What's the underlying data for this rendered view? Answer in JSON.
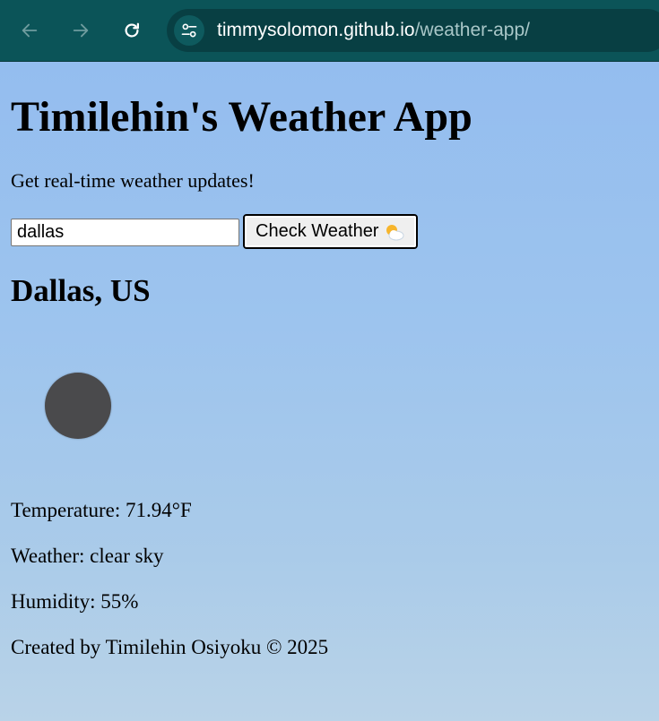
{
  "browser": {
    "url_host": "timmysolomon.github.io",
    "url_path": "/weather-app/",
    "icons": {
      "back": "arrow-left-icon",
      "forward": "arrow-right-icon",
      "reload": "reload-icon",
      "site_info": "tune-icon"
    }
  },
  "page": {
    "title": "Timilehin's Weather App",
    "subtitle": "Get real-time weather updates!",
    "search": {
      "value": "dallas",
      "button_label": "Check Weather"
    },
    "result": {
      "city": "Dallas, US",
      "icon": "weather-icon",
      "temperature": "Temperature: 71.94°F",
      "description": "Weather: clear sky",
      "humidity": "Humidity: 55%"
    },
    "footer": "Created by Timilehin Osiyoku © 2025"
  },
  "colors": {
    "toolbar": "#0b5458",
    "omnibox": "#083f43",
    "sky": "#9bbfe8"
  }
}
